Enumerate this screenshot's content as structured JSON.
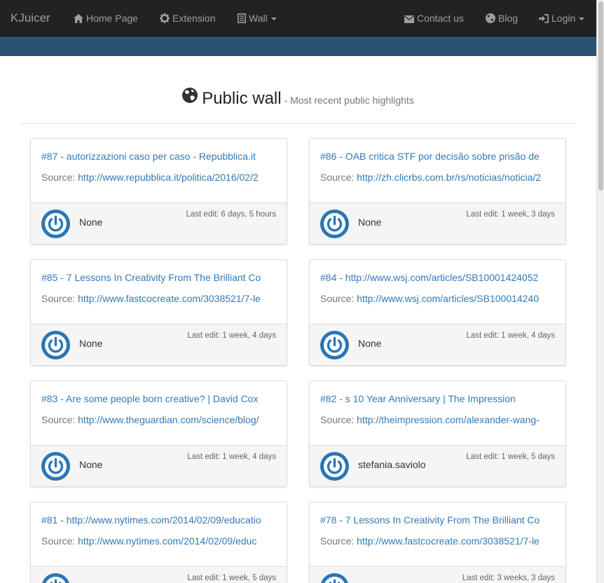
{
  "navbar": {
    "brand": "KJuicer",
    "items": [
      {
        "label": "Home Page",
        "icon": "home-icon"
      },
      {
        "label": "Extension",
        "icon": "gear-icon"
      },
      {
        "label": "Wall",
        "icon": "book-icon"
      },
      {
        "label": "Contact us",
        "icon": "envelope-icon"
      },
      {
        "label": "Blog",
        "icon": "globe-icon"
      },
      {
        "label": "Login",
        "icon": "login-icon"
      }
    ]
  },
  "header": {
    "title": "Public wall",
    "subtitle": "- Most recent public highlights"
  },
  "source_label": "Source:",
  "cards": [
    {
      "title": "#87 - autorizzazioni caso per caso - Repubblica.it",
      "url": "http://www.repubblica.it/politica/2016/02/2",
      "user": "None",
      "last_edit": "Last edit: 6 days, 5 hours"
    },
    {
      "title": "#86 - OAB critica STF por decisão sobre prisão de",
      "url": "http://zh.clicrbs.com.br/rs/noticias/noticia/2",
      "user": "None",
      "last_edit": "Last edit: 1 week, 3 days"
    },
    {
      "title": "#85 - 7 Lessons In Creativity From The Brilliant Co",
      "url": "http://www.fastcocreate.com/3038521/7-le",
      "user": "None",
      "last_edit": "Last edit: 1 week, 4 days"
    },
    {
      "title": "#84 - http://www.wsj.com/articles/SB10001424052",
      "url": "http://www.wsj.com/articles/SB100014240",
      "user": "None",
      "last_edit": "Last edit: 1 week, 4 days"
    },
    {
      "title": "#83 - Are some people born creative? | David Cox",
      "url": "http://www.theguardian.com/science/blog/",
      "user": "None",
      "last_edit": "Last edit: 1 week, 4 days"
    },
    {
      "title": "#82 - s 10 Year Anniversary | The Impression",
      "url": "http://theimpression.com/alexander-wang-",
      "user": "stefania.saviolo",
      "last_edit": "Last edit: 1 week, 5 days"
    },
    {
      "title": "#81 - http://www.nytimes.com/2014/02/09/educatio",
      "url": "http://www.nytimes.com/2014/02/09/educ",
      "user": "",
      "last_edit": "Last edit: 1 week, 5 days"
    },
    {
      "title": "#78 - 7 Lessons In Creativity From The Brilliant Co",
      "url": "http://www.fastcocreate.com/3038521/7-le",
      "user": "",
      "last_edit": "Last edit: 3 weeks, 3 days"
    }
  ],
  "colors": {
    "navbar_bg": "#222222",
    "band": "#2c5273",
    "link": "#337ab7",
    "avatar_ring": "#2a76b4"
  }
}
